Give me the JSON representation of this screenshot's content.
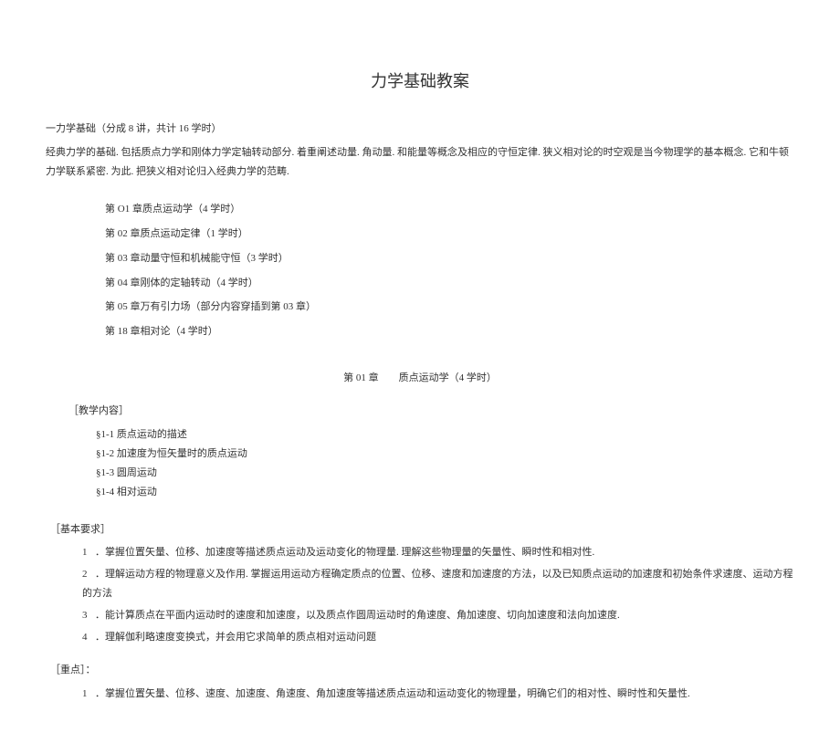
{
  "title": "力学基础教案",
  "intro_line": "一力学基础（分成 8 讲，共计 16 学时）",
  "intro_desc": "经典力学的基础. 包括质点力学和刚体力学定轴转动部分. 着重阐述动量. 角动量. 和能量等概念及相应的守恒定律. 狭义相对论的时空观是当今物理学的基本概念. 它和牛顿力学联系紧密. 为此. 把狭义相对论归入经典力学的范畴.",
  "chapters": [
    "第 O1 章质点运动学（4 学时）",
    "第 02 章质点运动定律（1 学时）",
    "第 03 章动量守恒和机械能守恒（3 学时）",
    "第 04 章刚体的定轴转动（4 学时）",
    "第 05 章万有引力场（部分内容穿插到第 03 章）",
    "第 18 章相对论（4 学时）"
  ],
  "section_heading": "第 01 章  质点运动学（4 学时）",
  "teaching_label": "［教学内容］",
  "teaching_items": [
    "§1-1 质点运动的描述",
    "§1-2 加速度为恒矢量时的质点运动",
    "§1-3 圆周运动",
    "§1-4 相对运动"
  ],
  "requirements_label": "［基本要求］",
  "requirements_items": [
    {
      "num": "1",
      "text": "．掌握位置矢量、位移、加速度等描述质点运动及运动变化的物理量. 理解这些物理量的矢量性、瞬时性和相对性."
    },
    {
      "num": "2",
      "text": "．理解运动方程的物理意义及作用. 掌握运用运动方程确定质点的位置、位移、速度和加速度的方法，以及已知质点运动的加速度和初始条件求速度、运动方程的方法"
    },
    {
      "num": "3",
      "text": "．能计算质点在平面内运动时的速度和加速度，以及质点作圆周运动时的角速度、角加速度、切向加速度和法向加速度."
    },
    {
      "num": "4",
      "text": "．理解伽利略速度变换式，并会用它求简单的质点相对运动问题"
    }
  ],
  "emphasis_label": "［重点］：",
  "emphasis_items": [
    {
      "num": "1",
      "text": "．掌握位置矢量、位移、速度、加速度、角速度、角加速度等描述质点运动和运动变化的物理量，明确它们的相对性、瞬时性和矢量性."
    }
  ]
}
